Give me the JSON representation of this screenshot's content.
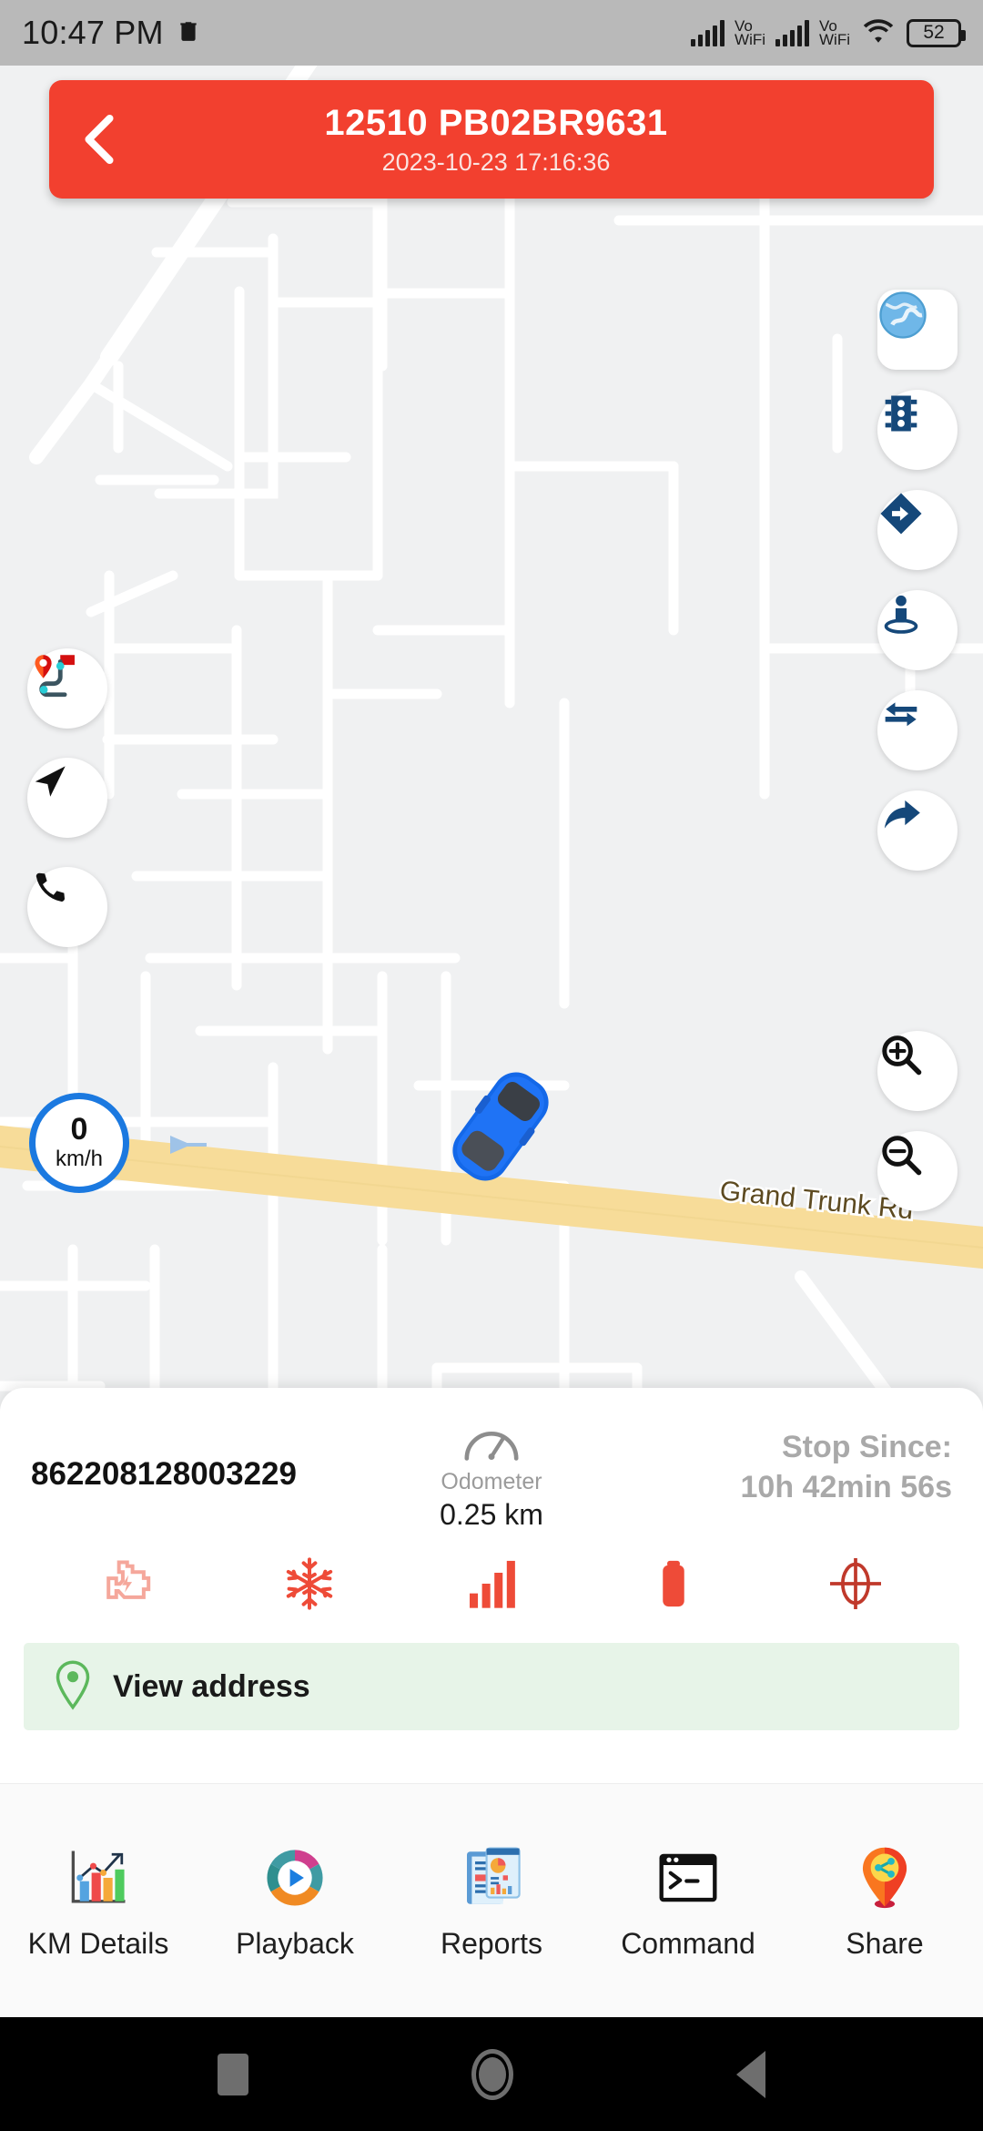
{
  "status_bar": {
    "clock": "10:47 PM",
    "trash_icon": "trash-icon",
    "sim1_label_top": "Vo",
    "sim1_label_bottom": "WiFi",
    "sim2_label_top": "Vo",
    "sim2_label_bottom": "WiFi",
    "wifi_icon": "wifi-icon",
    "battery_level": "52"
  },
  "header": {
    "back_icon": "back-chevron-icon",
    "title": "12510 PB02BR9631",
    "datetime": "2023-10-23 17:16:36",
    "bg_color": "#F2402F"
  },
  "map": {
    "road_label": "Grand Trunk Rd",
    "road_color": "#F7DC99",
    "background_color": "#F0F1F2",
    "vehicle_marker": "blue-car-marker",
    "right_controls": [
      {
        "name": "satellite-layer-button",
        "icon": "globe-icon"
      },
      {
        "name": "traffic-button",
        "icon": "traffic-light-icon"
      },
      {
        "name": "directions-button",
        "icon": "directions-diamond-icon"
      },
      {
        "name": "street-view-button",
        "icon": "street-view-person-icon"
      },
      {
        "name": "swap-button",
        "icon": "swap-arrows-icon"
      },
      {
        "name": "share-route-button",
        "icon": "share-arrow-icon"
      }
    ],
    "zoom_controls": [
      {
        "name": "zoom-in-button",
        "icon": "magnifier-plus-icon"
      },
      {
        "name": "zoom-out-button",
        "icon": "magnifier-minus-icon"
      }
    ],
    "left_controls": [
      {
        "name": "route-history-button",
        "icon": "route-pin-flag-icon"
      },
      {
        "name": "navigate-button",
        "icon": "navigation-arrow-icon"
      },
      {
        "name": "call-button",
        "icon": "phone-icon"
      }
    ],
    "speed": {
      "value": "0",
      "unit": "km/h",
      "ring_color": "#1B79E0"
    }
  },
  "info_panel": {
    "imei": "862208128003229",
    "odometer_icon": "speedometer-icon",
    "odometer_label": "Odometer",
    "odometer_value": "0.25 km",
    "stop_since_label": "Stop Since:",
    "stop_since_value": "10h 42min 56s",
    "status_icons": [
      {
        "name": "engine-status-icon",
        "color": "#F5A79B"
      },
      {
        "name": "ac-snowflake-status-icon",
        "color": "#EE4B38"
      },
      {
        "name": "signal-status-icon",
        "color": "#EE4B38"
      },
      {
        "name": "battery-status-icon",
        "color": "#EE4B38"
      },
      {
        "name": "gps-crosshair-status-icon",
        "color": "#C0392B"
      }
    ],
    "address": {
      "icon": "location-pin-icon",
      "label": "View address",
      "bg_color": "#E7F4E8",
      "icon_color": "#5CB85C"
    }
  },
  "bottom_nav": [
    {
      "name": "nav-km-details",
      "label": "KM Details",
      "icon": "bar-chart-icon"
    },
    {
      "name": "nav-playback",
      "label": "Playback",
      "icon": "play-donut-icon"
    },
    {
      "name": "nav-reports",
      "label": "Reports",
      "icon": "report-document-icon"
    },
    {
      "name": "nav-command",
      "label": "Command",
      "icon": "terminal-icon"
    },
    {
      "name": "nav-share",
      "label": "Share",
      "icon": "share-pin-icon"
    }
  ],
  "android_nav": {
    "recents": "recents-square-icon",
    "home": "home-circle-icon",
    "back": "back-triangle-icon"
  }
}
